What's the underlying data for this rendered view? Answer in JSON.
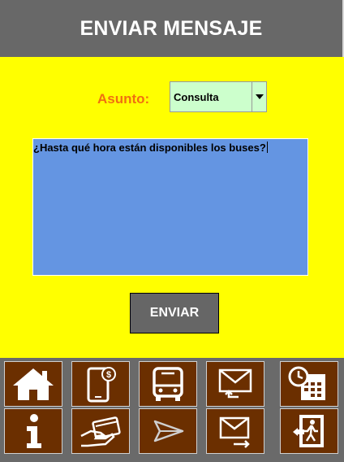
{
  "header": {
    "title": "ENVIAR MENSAJE"
  },
  "form": {
    "subject_label": "Asunto:",
    "subject_value": "Consulta",
    "message": "¿Hasta qué hora están disponibles los buses?",
    "send_label": "ENVIAR"
  },
  "colors": {
    "form_background": "#ffff00",
    "header_background": "#686868",
    "label_color": "#f07010",
    "select_background": "#ccffcc",
    "message_background": "#6495e2",
    "nav_button_background": "#6b2f00"
  },
  "nav": {
    "icons": [
      "home-icon",
      "mobile-payment-icon",
      "bus-icon",
      "reply-mail-icon",
      "calendar-clock-icon",
      "info-icon",
      "card-payment-icon",
      "send-icon",
      "send-mail-icon",
      "exit-icon"
    ]
  }
}
